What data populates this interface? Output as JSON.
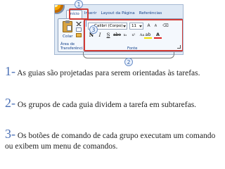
{
  "ribbon": {
    "tabs": [
      "Início",
      "Inserir",
      "Layout da Página",
      "Referências"
    ],
    "clipboard": {
      "paste_label": "Colar",
      "group_label": "Área de Transferência"
    },
    "font": {
      "name_value": "Calibri (Corpo)",
      "size_value": "11",
      "group_label": "Fonte"
    },
    "format_buttons": [
      "N",
      "I",
      "S",
      "abe",
      "x₂",
      "x²",
      "Aa"
    ],
    "color_buttons": [
      "ab",
      "A"
    ]
  },
  "callouts": {
    "one": "1",
    "two": "2",
    "three": "3"
  },
  "paragraphs": [
    {
      "number": "1",
      "dash": "-",
      "text": " As guias são projetadas para serem orientadas às tarefas."
    },
    {
      "number": "2",
      "dash": "-",
      "text": " Os grupos de cada guia dividem a tarefa em subtarefas."
    },
    {
      "number": "3",
      "dash": "-",
      "text": " Os botões de comando de cada grupo executam um comando ou exibem um menu de comandos."
    }
  ],
  "colors": {
    "accent": "#4a6fb5",
    "highlight_border": "#d23b35",
    "ribbon_bg": "#dfe9f5"
  }
}
